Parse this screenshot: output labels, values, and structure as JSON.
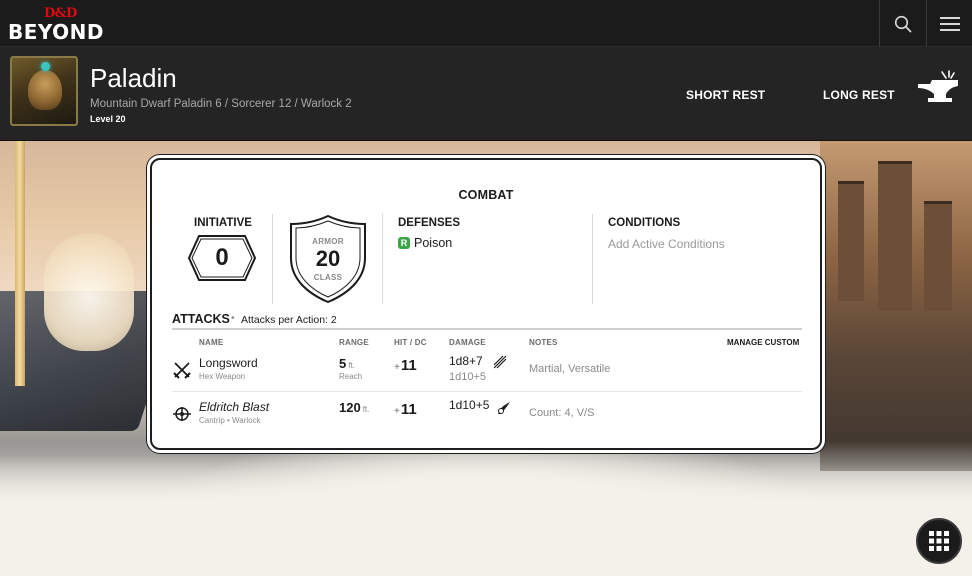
{
  "nav": {
    "logo_top": "D&D",
    "logo_bottom": "BEYOND",
    "search_icon": "search-icon",
    "menu_icon": "hamburger-menu-icon"
  },
  "character": {
    "name": "Paladin",
    "subtitle": "Mountain Dwarf  Paladin 6 / Sorcerer 12 / Warlock 2",
    "level": "Level 20",
    "short_rest": "SHORT REST",
    "long_rest": "LONG REST"
  },
  "combat": {
    "title": "COMBAT",
    "initiative_label": "INITIATIVE",
    "initiative_value": "0",
    "armor_top": "ARMOR",
    "armor_value": "20",
    "armor_bottom": "CLASS",
    "defenses_label": "DEFENSES",
    "defense_badge": "R",
    "defense_item": "Poison",
    "conditions_label": "CONDITIONS",
    "conditions_placeholder": "Add Active Conditions"
  },
  "attacks": {
    "title": "ATTACKS",
    "dot": "•",
    "per_action": "Attacks per Action: 2",
    "headers": {
      "name": "NAME",
      "range": "RANGE",
      "hit": "HIT / DC",
      "damage": "DAMAGE",
      "notes": "NOTES",
      "manage": "MANAGE CUSTOM"
    },
    "rows": [
      {
        "name": "Longsword",
        "sub": "Hex Weapon",
        "range": "5",
        "range_unit": "ft.",
        "range_sub": "Reach",
        "hit_sign": "+",
        "hit": "11",
        "damage": "1d8+7",
        "damage_alt": "1d10+5",
        "notes": "Martial, Versatile",
        "icon": "crossed-swords-icon"
      },
      {
        "name": "Eldritch Blast",
        "sub": "Cantrip • Warlock",
        "range": "120",
        "range_unit": "ft.",
        "range_sub": "",
        "hit_sign": "+",
        "hit": "11",
        "damage": "1d10+5",
        "damage_alt": "",
        "notes": "Count: 4, V/S",
        "icon": "spell-sigil-icon"
      }
    ]
  },
  "colors": {
    "accent_red": "#e40712",
    "resistance_green": "#3aa548",
    "header_bg": "#242424"
  }
}
